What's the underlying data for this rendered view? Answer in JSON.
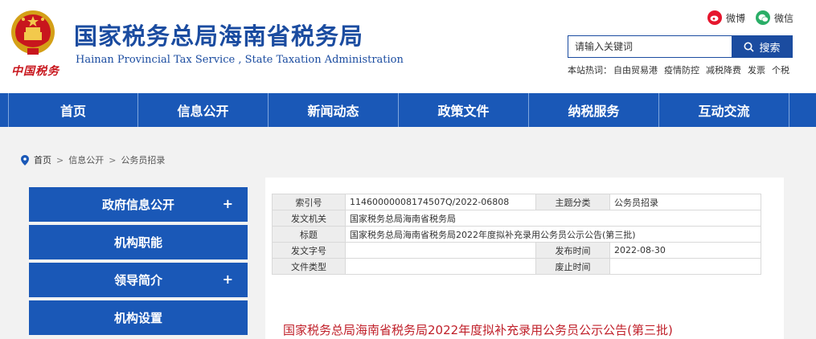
{
  "header": {
    "emblem_caption": "中国税务",
    "title": "国家税务总局海南省税务局",
    "subtitle": "Hainan Provincial Tax Service , State Taxation Administration",
    "social": [
      {
        "label": "微博",
        "icon": "weibo-icon",
        "color": "#e6162d"
      },
      {
        "label": "微信",
        "icon": "wechat-icon",
        "color": "#2aae67"
      }
    ],
    "search": {
      "placeholder": "请输入关键词",
      "button_label": "搜索"
    },
    "hot_words_label": "本站热词：",
    "hot_words": [
      "自由贸易港",
      "疫情防控",
      "减税降费",
      "发票",
      "个税"
    ]
  },
  "nav": {
    "items": [
      "首页",
      "信息公开",
      "新闻动态",
      "政策文件",
      "纳税服务",
      "互动交流"
    ]
  },
  "breadcrumb": {
    "items": [
      "首页",
      "信息公开",
      "公务员招录"
    ],
    "separator": ">"
  },
  "sidebar": {
    "items": [
      {
        "label": "政府信息公开",
        "expand": "+"
      },
      {
        "label": "机构职能",
        "expand": ""
      },
      {
        "label": "领导简介",
        "expand": "+"
      },
      {
        "label": "机构设置",
        "expand": ""
      }
    ]
  },
  "meta": {
    "index_label": "索引号",
    "index_value": "11460000008174507Q/2022-06808",
    "category_label": "主题分类",
    "category_value": "公务员招录",
    "issuer_label": "发文机关",
    "issuer_value": "国家税务总局海南省税务局",
    "title_label": "标题",
    "title_value": "国家税务总局海南省税务局2022年度拟补充录用公务员公示公告(第三批)",
    "docno_label": "发文字号",
    "docno_value": "",
    "pubdate_label": "发布时间",
    "pubdate_value": "2022-08-30",
    "doctype_label": "文件类型",
    "doctype_value": "",
    "abolish_label": "废止时间",
    "abolish_value": ""
  },
  "article": {
    "title": "国家税务总局海南省税务局2022年度拟补充录用公务员公示公告(第三批)"
  },
  "colors": {
    "brand_blue": "#1a58b7",
    "title_blue": "#1b4ca0",
    "article_red": "#c0202a",
    "emblem_red": "#c8161d"
  }
}
